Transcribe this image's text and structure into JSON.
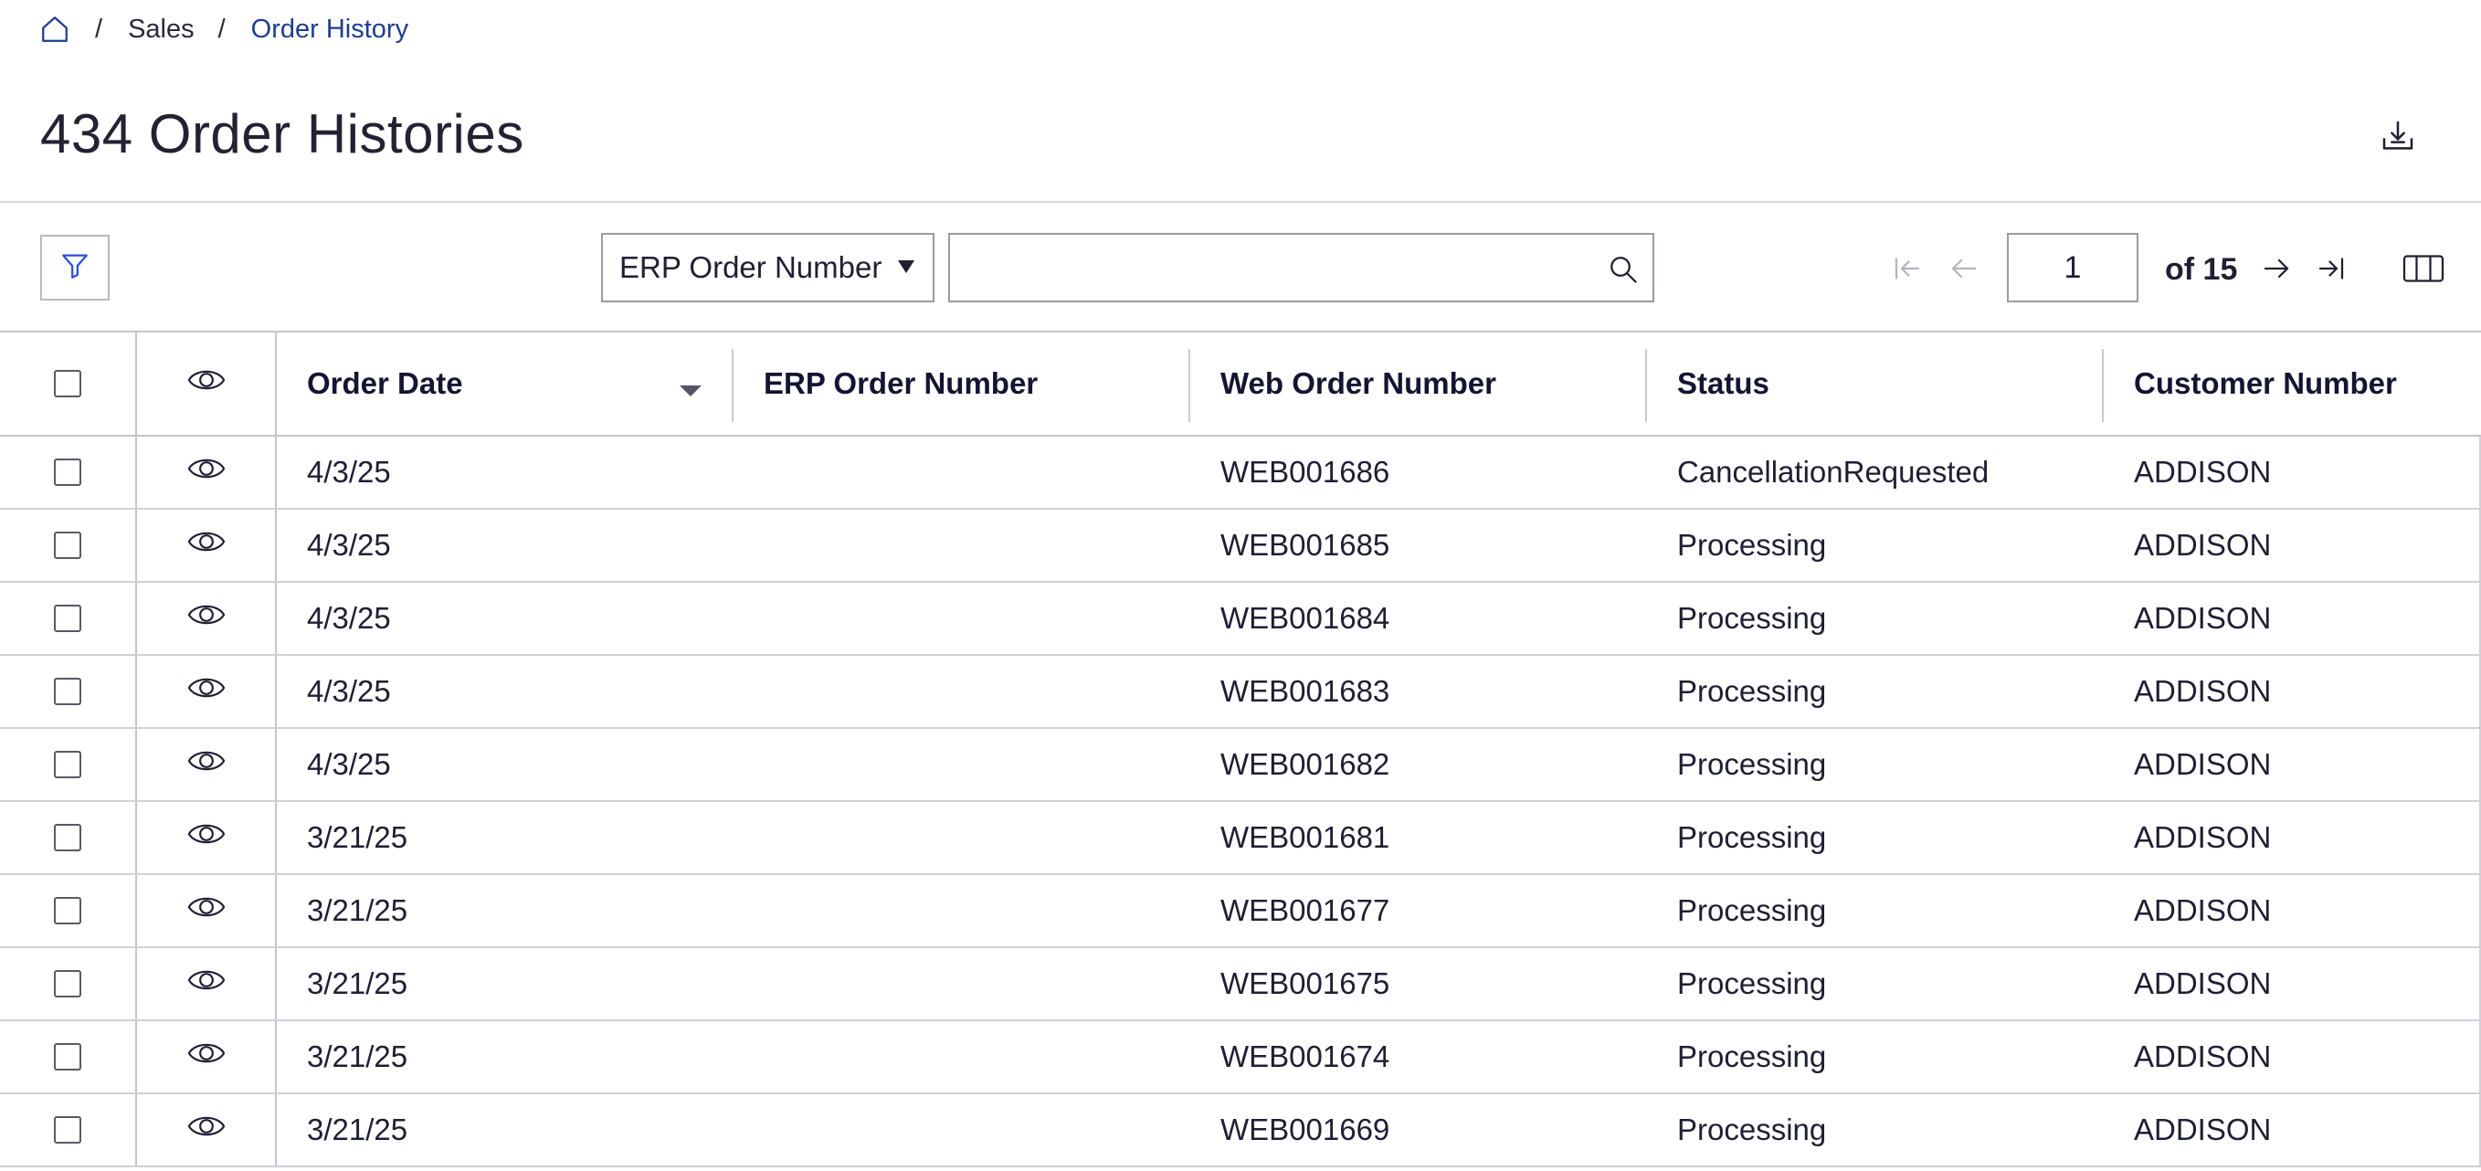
{
  "breadcrumb": {
    "home_icon": "home-icon",
    "separator": "/",
    "items": [
      "Sales",
      "Order History"
    ]
  },
  "header": {
    "title": "434 Order Histories",
    "download_icon": "download-icon"
  },
  "toolbar": {
    "filter_icon": "filter-icon",
    "search_field_selected": "ERP Order Number",
    "search_value": "",
    "search_icon": "search-icon",
    "pager": {
      "current_page": "1",
      "of_label": "of 15"
    },
    "columns_icon": "columns-icon"
  },
  "table": {
    "columns": [
      "Order Date",
      "ERP Order Number",
      "Web Order Number",
      "Status",
      "Customer Number"
    ],
    "sorted_column": "Order Date",
    "rows": [
      {
        "order_date": "4/3/25",
        "erp_order_number": "",
        "web_order_number": "WEB001686",
        "status": "CancellationRequested",
        "customer_number": "ADDISON"
      },
      {
        "order_date": "4/3/25",
        "erp_order_number": "",
        "web_order_number": "WEB001685",
        "status": "Processing",
        "customer_number": "ADDISON"
      },
      {
        "order_date": "4/3/25",
        "erp_order_number": "",
        "web_order_number": "WEB001684",
        "status": "Processing",
        "customer_number": "ADDISON"
      },
      {
        "order_date": "4/3/25",
        "erp_order_number": "",
        "web_order_number": "WEB001683",
        "status": "Processing",
        "customer_number": "ADDISON"
      },
      {
        "order_date": "4/3/25",
        "erp_order_number": "",
        "web_order_number": "WEB001682",
        "status": "Processing",
        "customer_number": "ADDISON"
      },
      {
        "order_date": "3/21/25",
        "erp_order_number": "",
        "web_order_number": "WEB001681",
        "status": "Processing",
        "customer_number": "ADDISON"
      },
      {
        "order_date": "3/21/25",
        "erp_order_number": "",
        "web_order_number": "WEB001677",
        "status": "Processing",
        "customer_number": "ADDISON"
      },
      {
        "order_date": "3/21/25",
        "erp_order_number": "",
        "web_order_number": "WEB001675",
        "status": "Processing",
        "customer_number": "ADDISON"
      },
      {
        "order_date": "3/21/25",
        "erp_order_number": "",
        "web_order_number": "WEB001674",
        "status": "Processing",
        "customer_number": "ADDISON"
      },
      {
        "order_date": "3/21/25",
        "erp_order_number": "",
        "web_order_number": "WEB001669",
        "status": "Processing",
        "customer_number": "ADDISON"
      }
    ]
  },
  "colors": {
    "link": "#1d3d8f",
    "accent": "#2c4fd6",
    "border": "#c5c5cf",
    "text": "#1f1f33"
  }
}
